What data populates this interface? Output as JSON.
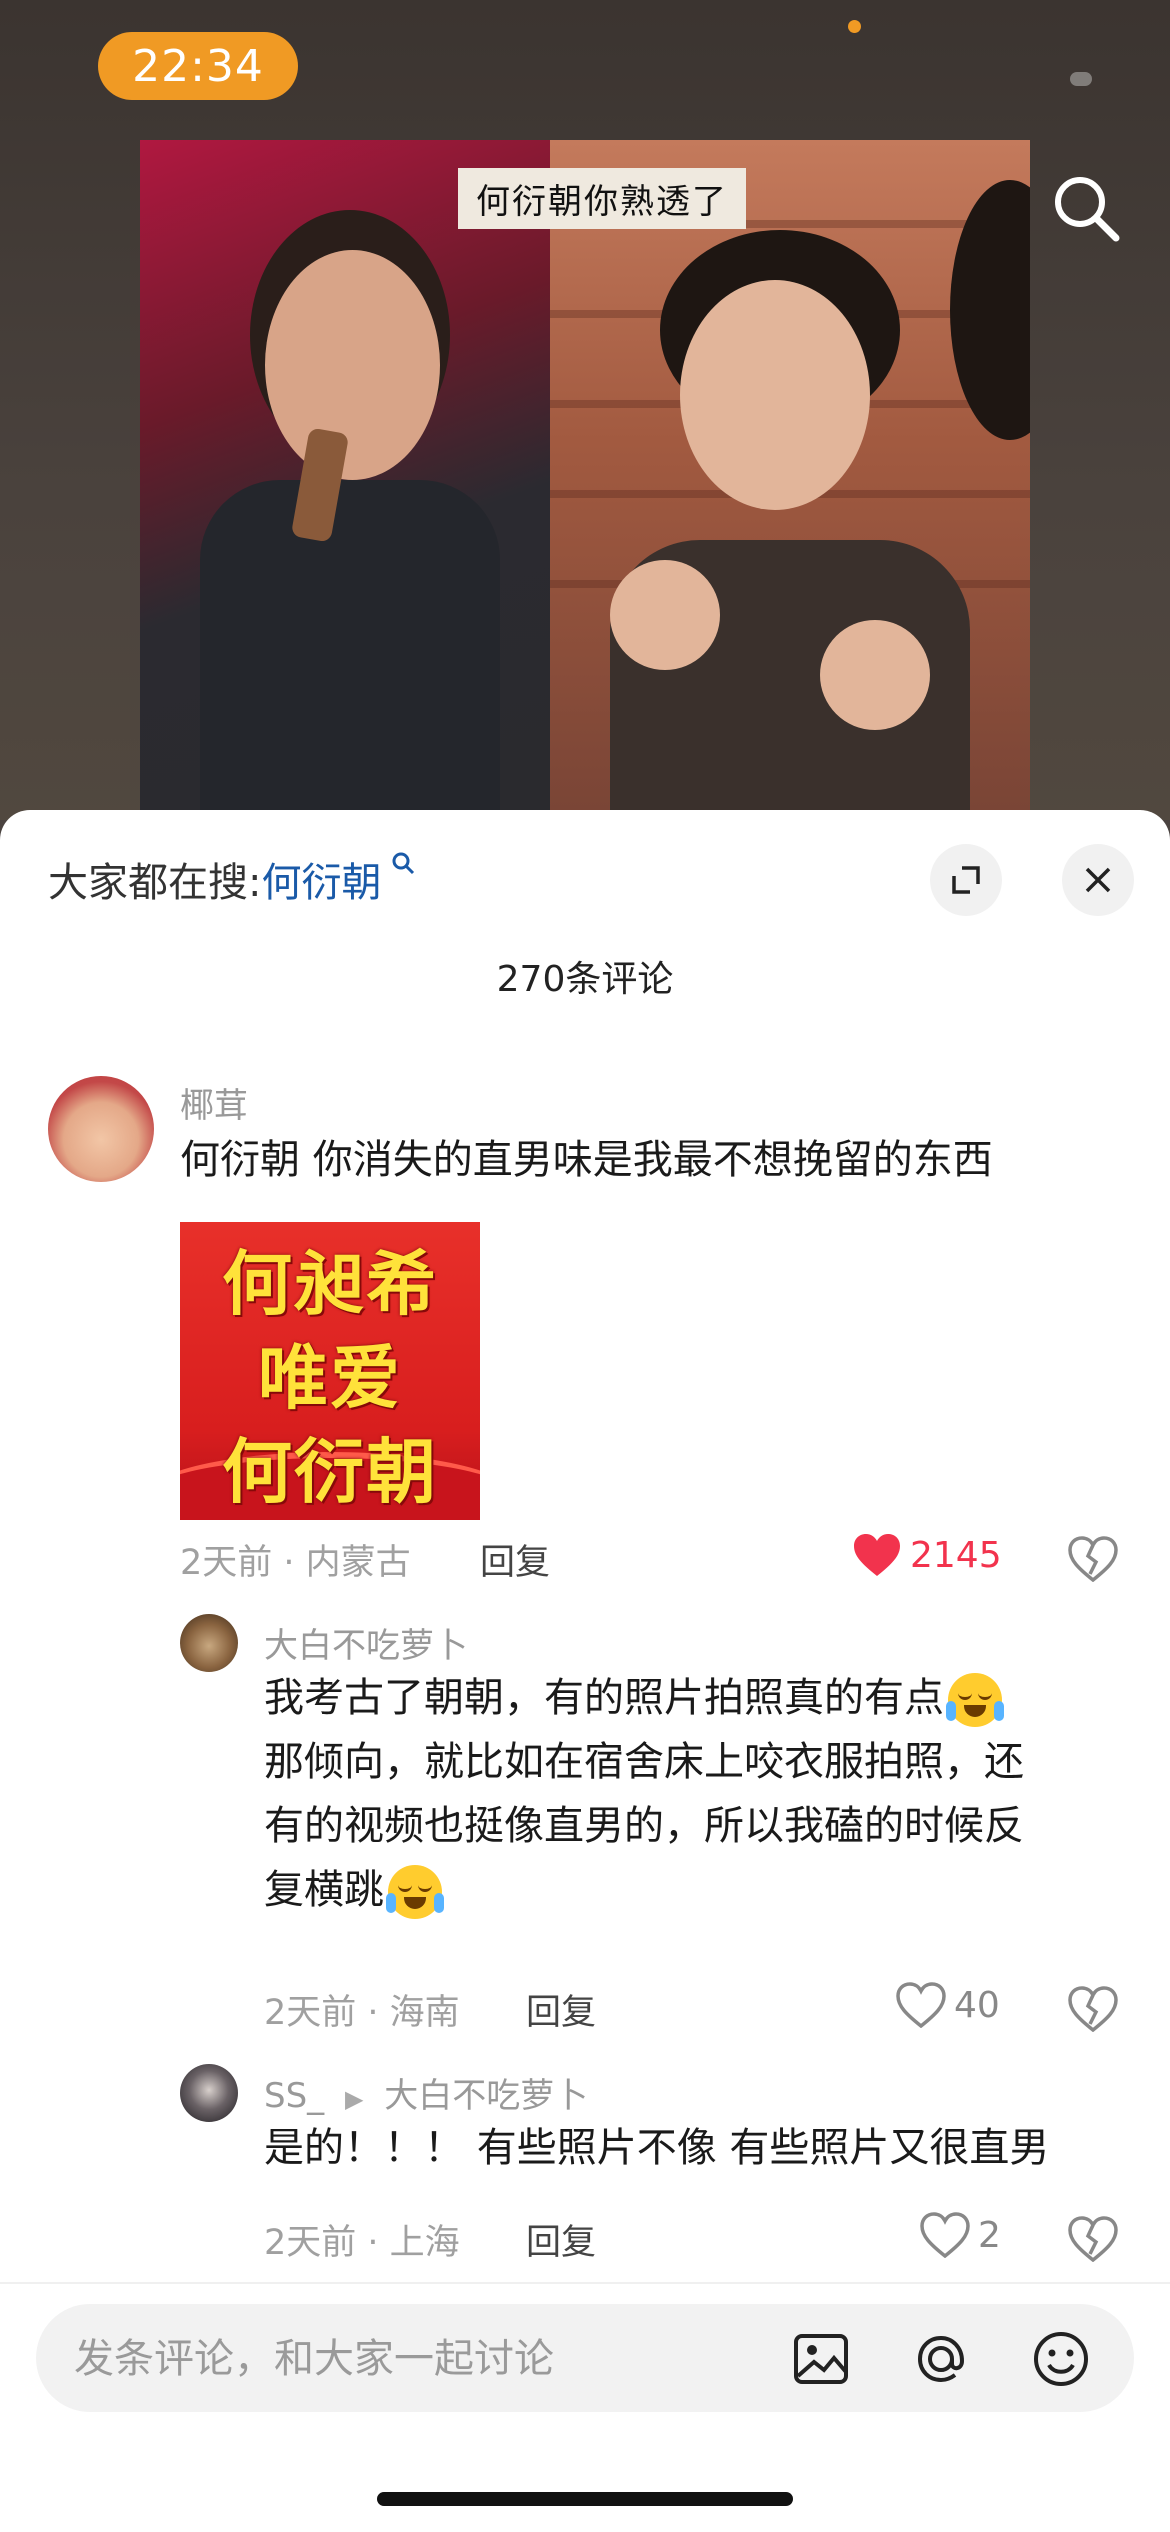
{
  "status": {
    "time": "22:34"
  },
  "media": {
    "caption": "何衍朝你熟透了"
  },
  "sheet": {
    "trending_prefix": "大家都在搜:",
    "trending_keyword": "何衍朝",
    "comment_count": "270条评论"
  },
  "comments": [
    {
      "user": "椰茸",
      "text": "何衍朝 你消失的直男味是我最不想挽留的东西",
      "sticker_lines": [
        "何昶希",
        "唯爱",
        "何衍朝"
      ],
      "meta": "2天前 · 内蒙古",
      "reply_label": "回复",
      "likes": "2145"
    },
    {
      "user": "大白不吃萝卜",
      "text_lines": [
        "我考古了朝朝，有的照片拍照真的有点",
        "那倾向，就比如在宿舍床上咬衣服拍照，还",
        "有的视频也挺像直男的，所以我磕的时候反",
        "复横跳"
      ],
      "meta": "2天前 · 海南",
      "reply_label": "回复",
      "likes": "40"
    },
    {
      "user": "SS_",
      "reply_to": "大白不吃萝卜",
      "text": "是的！！！ 有些照片不像 有些照片又很直男",
      "meta": "2天前 · 上海",
      "reply_label": "回复",
      "likes": "2"
    }
  ],
  "composer": {
    "placeholder": "发条评论，和大家一起讨论"
  },
  "colors": {
    "accent_orange": "#f09a24",
    "like_red": "#f2334d",
    "link_blue": "#1a5aa8"
  }
}
